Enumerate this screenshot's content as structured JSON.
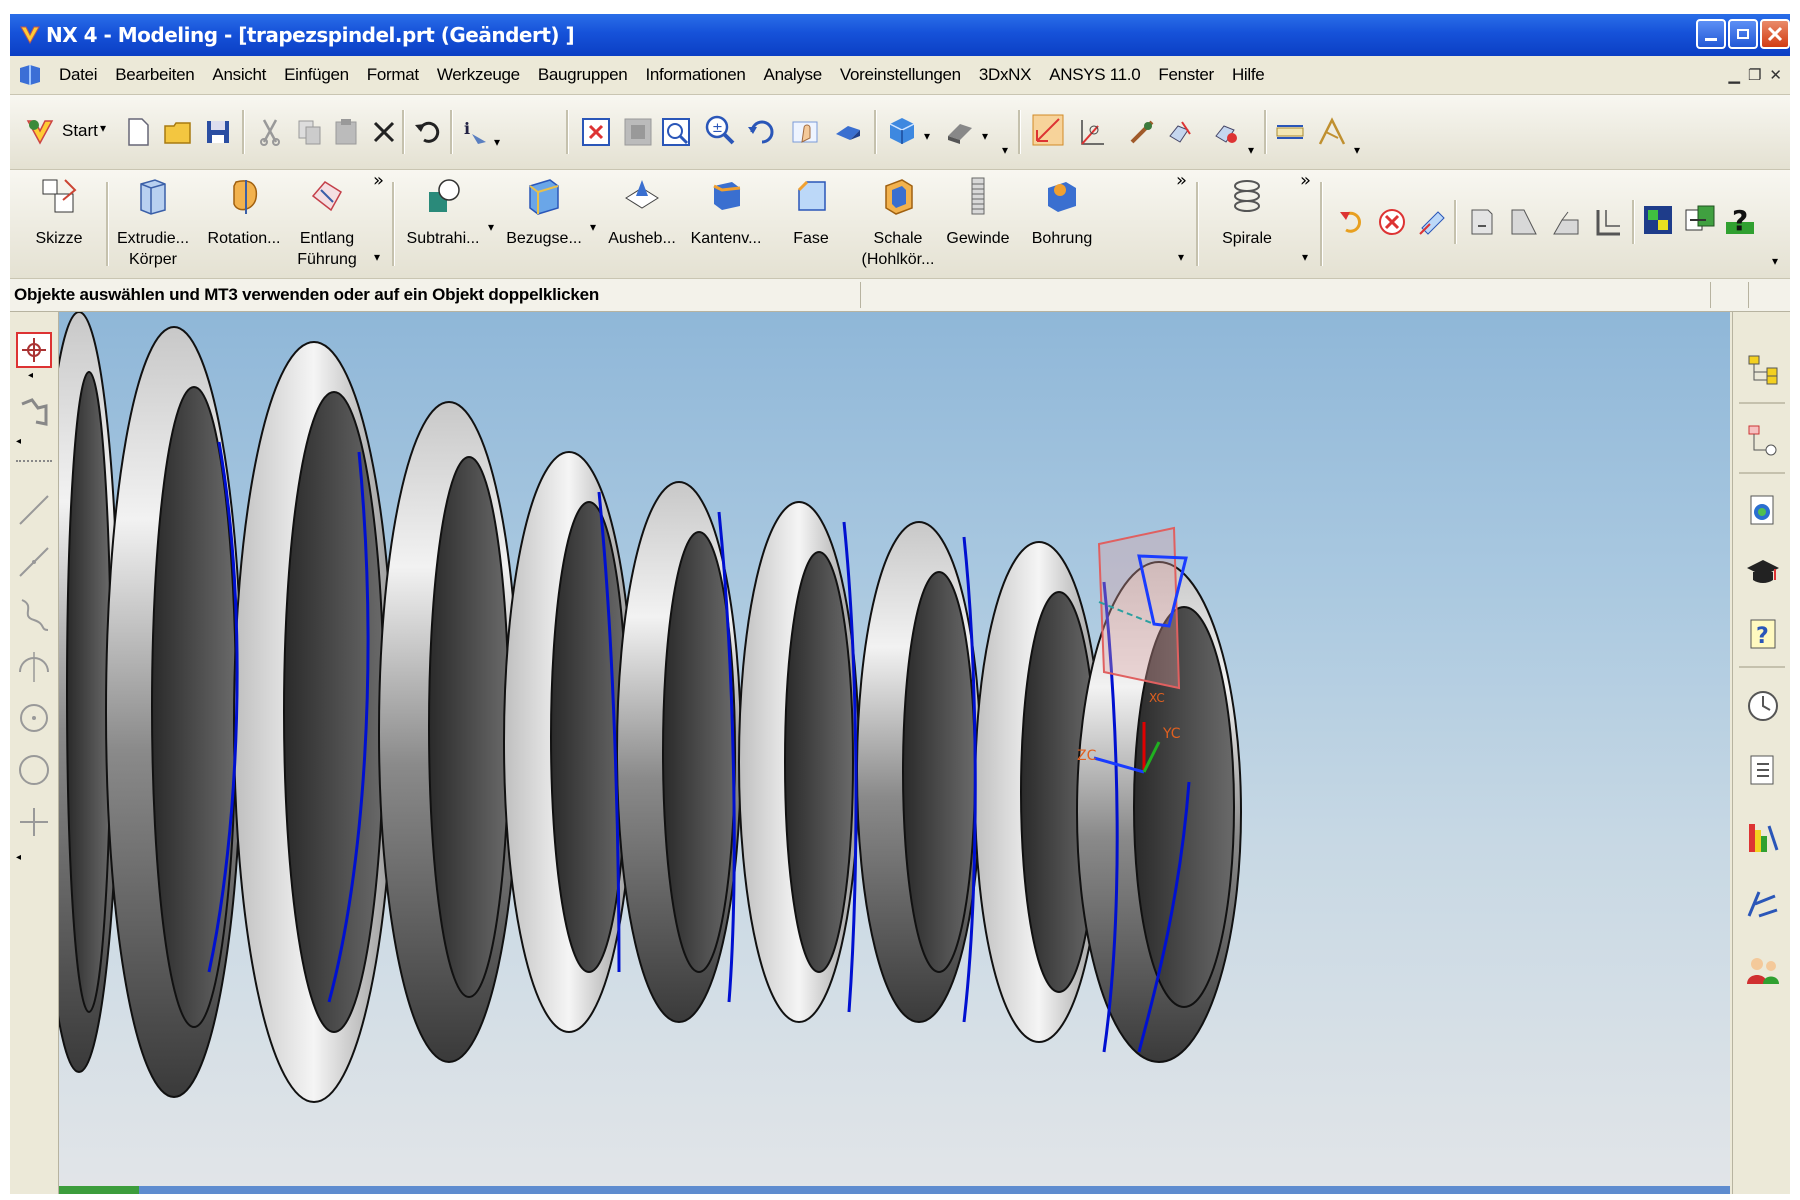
{
  "window": {
    "title": "NX 4 - Modeling - [trapezspindel.prt (Geändert) ]"
  },
  "menu": {
    "items": [
      "Datei",
      "Bearbeiten",
      "Ansicht",
      "Einfügen",
      "Format",
      "Werkzeuge",
      "Baugruppen",
      "Informationen",
      "Analyse",
      "Voreinstellungen",
      "3DxNX",
      "ANSYS 11.0",
      "Fenster",
      "Hilfe"
    ]
  },
  "toolbar": {
    "start_label": "Start"
  },
  "features": {
    "skizze": "Skizze",
    "extrude_1": "Extrudie...",
    "extrude_2": "Körper",
    "rotation": "Rotation...",
    "entlang_1": "Entlang",
    "entlang_2": "Führung",
    "subtrahieren": "Subtrahi...",
    "bezug": "Bezugse...",
    "aushoehlen": "Ausheb...",
    "kanten": "Kantenv...",
    "fase": "Fase",
    "schale_1": "Schale",
    "schale_2": "(Hohlkör...",
    "gewinde": "Gewinde",
    "bohrung": "Bohrung",
    "spirale": "Spirale",
    "more_glyph": "»"
  },
  "status": {
    "prompt": "Objekte auswählen und MT3 verwenden oder auf ein Objekt doppelklicken"
  },
  "viewport": {
    "axis_zc": "ZC",
    "axis_yc": "YC",
    "axis_xc": "XC"
  },
  "colors": {
    "titlebar": "#1652d9",
    "chrome": "#ece9d8",
    "sky_top": "#8fb7d8",
    "curve": "#0000cc",
    "datum_plane": "#e0a0a0"
  }
}
